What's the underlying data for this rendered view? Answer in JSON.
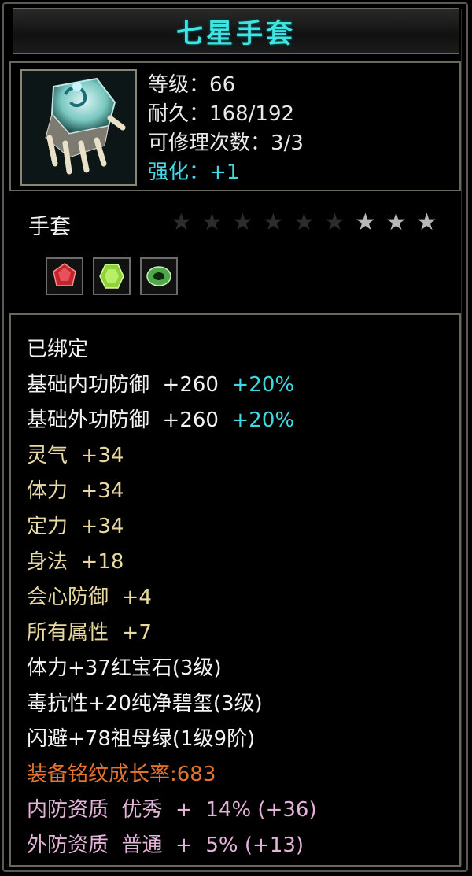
{
  "title": "七星手套",
  "stats": {
    "level_label": "等级",
    "level_value": "66",
    "durability_label": "耐久",
    "durability_value": "168/192",
    "repair_label": "可修理次数",
    "repair_value": "3/3",
    "enhance_label": "强化",
    "enhance_value": "+1"
  },
  "item_type": "手套",
  "stars": {
    "total": 9,
    "lit": 3
  },
  "gems": [
    {
      "name": "ruby-gem-icon",
      "color": "#c0262e"
    },
    {
      "name": "peridot-gem-icon",
      "color": "#8fd23a"
    },
    {
      "name": "jade-gem-icon",
      "color": "#4ea84a"
    }
  ],
  "attributes": {
    "bound": "已绑定",
    "inner_def_label": "基础内功防御",
    "inner_def_value": "+260",
    "inner_def_pct": "+20%",
    "outer_def_label": "基础外功防御",
    "outer_def_value": "+260",
    "outer_def_pct": "+20%",
    "lingqi": "灵气  +34",
    "tili": "体力  +34",
    "dingli": "定力  +34",
    "shenfa": "身法  +18",
    "huixin": "会心防御  +4",
    "suoyou": "所有属性  +7",
    "gem1": "体力+37红宝石(3级)",
    "gem2": "毒抗性+20纯净碧玺(3级)",
    "gem3": "闪避+78祖母绿(1级9阶)",
    "growth": "装备铭纹成长率:683",
    "inner_quality": "内防资质  优秀  +  14% (+36)",
    "outer_quality": "外防资质  普通  +  5% (+13)"
  },
  "colors": {
    "title": "#3fe3e0",
    "cyan": "#41d6e0",
    "yellow": "#e8d9a0",
    "orange": "#e4732f",
    "pink": "#e3b3d8"
  }
}
